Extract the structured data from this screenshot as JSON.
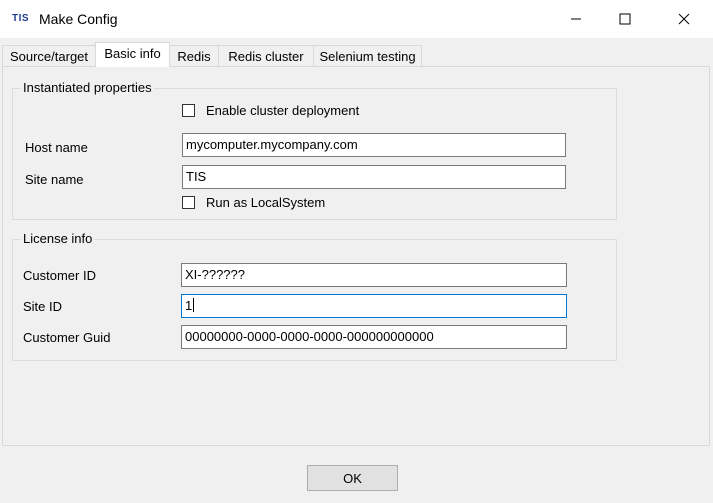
{
  "window": {
    "logo_text": "TIS",
    "title": "Make Config"
  },
  "tabs": [
    {
      "label": "Source/target",
      "active": false
    },
    {
      "label": "Basic info",
      "active": true
    },
    {
      "label": "Redis",
      "active": false
    },
    {
      "label": "Redis cluster",
      "active": false
    },
    {
      "label": "Selenium testing",
      "active": false
    }
  ],
  "instantiated": {
    "group_label": "Instantiated properties",
    "enable_cluster_label": "Enable cluster deployment",
    "enable_cluster_checked": false,
    "host_name_label": "Host name",
    "host_name_value": "mycomputer.mycompany.com",
    "site_name_label": "Site name",
    "site_name_value": "TIS",
    "run_as_label": "Run as LocalSystem",
    "run_as_checked": false
  },
  "license": {
    "group_label": "License info",
    "customer_id_label": "Customer ID",
    "customer_id_value": "XI-??????",
    "site_id_label": "Site ID",
    "site_id_value": "1",
    "customer_guid_label": "Customer Guid",
    "customer_guid_value": "00000000-0000-0000-0000-000000000000"
  },
  "footer": {
    "ok_label": "OK"
  },
  "colors": {
    "focus_border": "#0078d7",
    "logo": "#1f3d8f"
  }
}
